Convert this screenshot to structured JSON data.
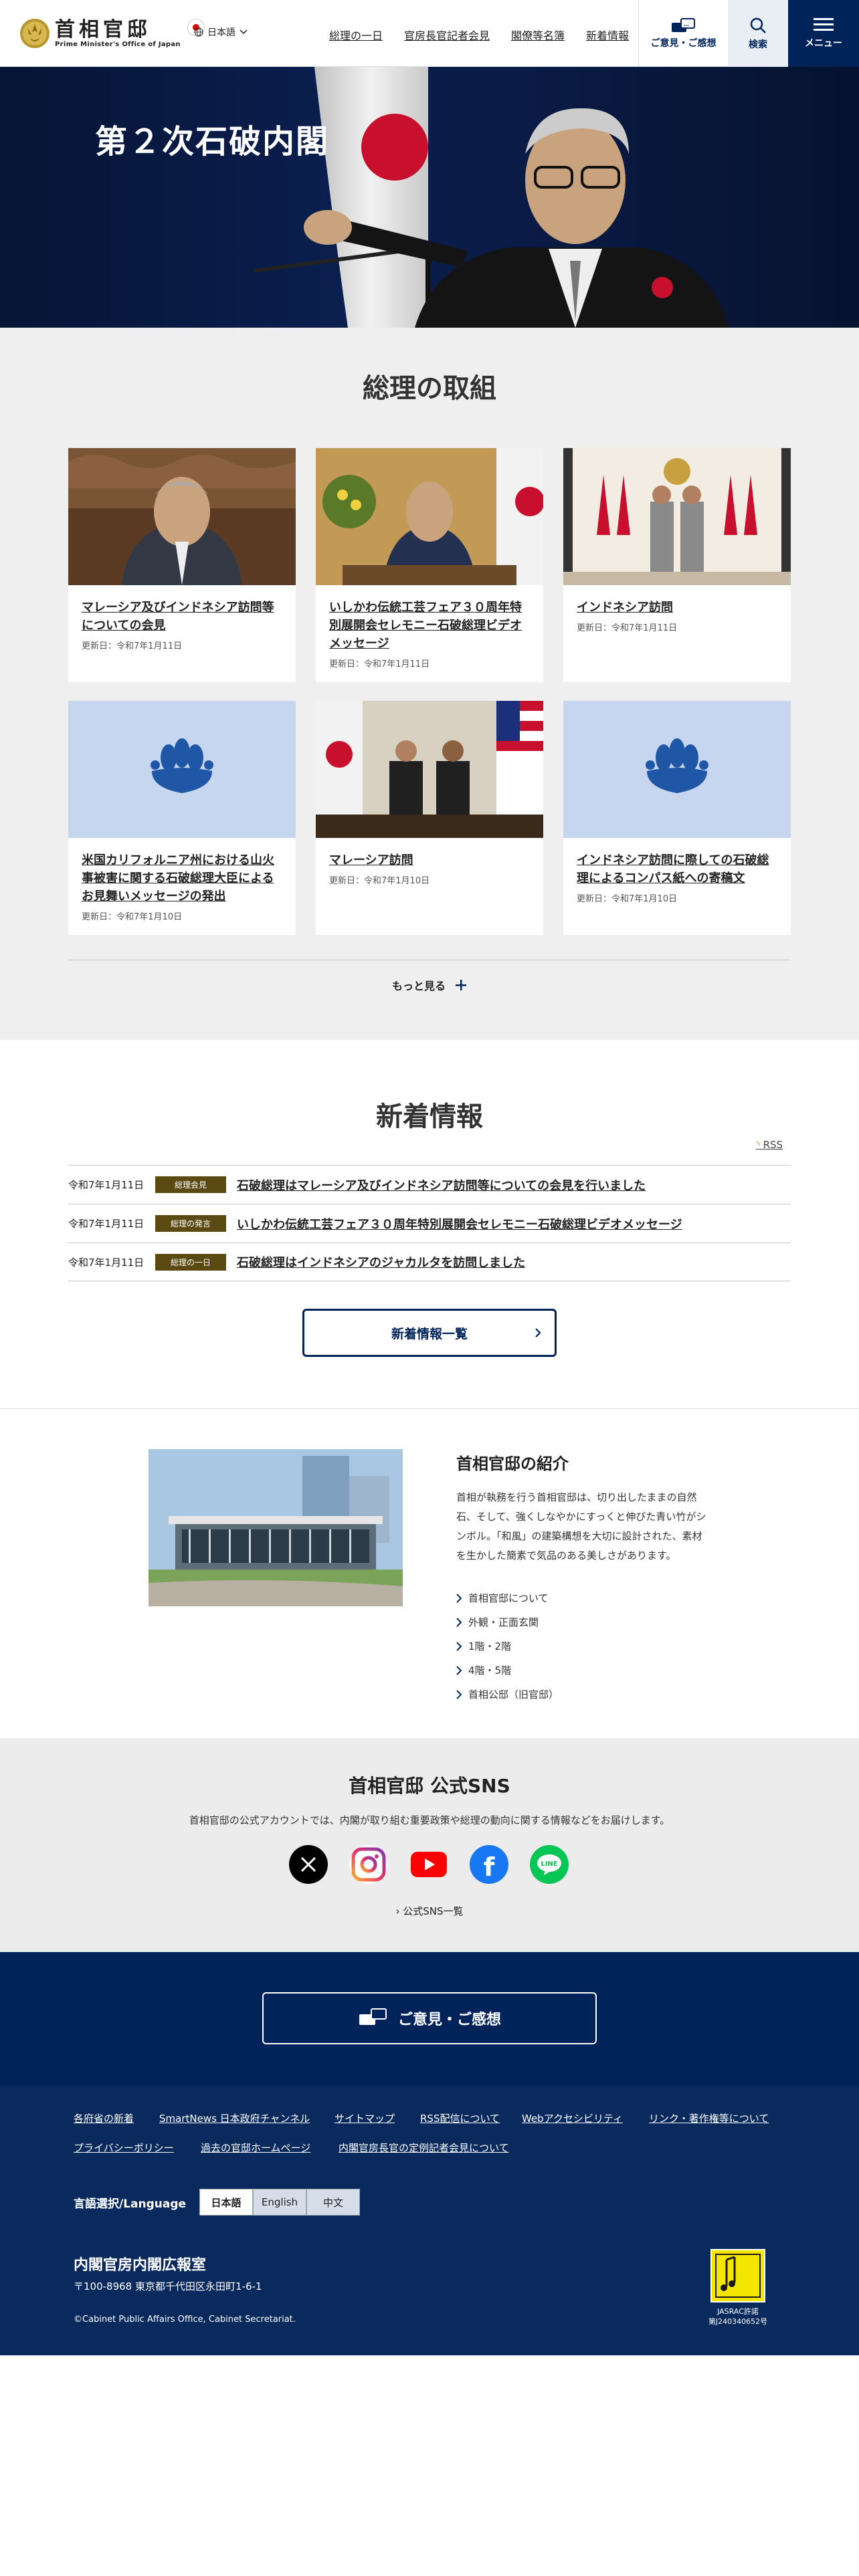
{
  "header": {
    "logo_jp": "首相官邸",
    "logo_en": "Prime Minister's Office of Japan",
    "language": "日本語",
    "nav": [
      "総理の一日",
      "官房長官記者会見",
      "閣僚等名簿",
      "新着情報"
    ],
    "opinion": "ご意見・ご感想",
    "search": "検索",
    "menu": "メニュー"
  },
  "hero": {
    "title": "第２次石破内閣"
  },
  "activities": {
    "heading": "総理の取組",
    "cards": [
      {
        "title": "マレーシア及びインドネシア訪問等についての会見",
        "date": "更新日：令和7年1月11日"
      },
      {
        "title": "いしかわ伝統工芸フェア３０周年特別展開会セレモニー石破総理ビデオメッセージ",
        "date": "更新日：令和7年1月11日"
      },
      {
        "title": "インドネシア訪問",
        "date": "更新日：令和7年1月11日"
      },
      {
        "title": "米国カリフォルニア州における山火事被害に関する石破総理大臣によるお見舞いメッセージの発出",
        "date": "更新日：令和7年1月10日"
      },
      {
        "title": "マレーシア訪問",
        "date": "更新日：令和7年1月10日"
      },
      {
        "title": "インドネシア訪問に際しての石破総理によるコンパス紙への寄稿文",
        "date": "更新日：令和7年1月10日"
      }
    ],
    "more": "もっと見る"
  },
  "news": {
    "heading": "新着情報",
    "rss": "RSS",
    "items": [
      {
        "date": "令和7年1月11日",
        "badge": "総理会見",
        "title": "石破総理はマレーシア及びインドネシア訪問等についての会見を行いました"
      },
      {
        "date": "令和7年1月11日",
        "badge": "総理の発言",
        "title": "いしかわ伝統工芸フェア３０周年特別展開会セレモニー石破総理ビデオメッセージ"
      },
      {
        "date": "令和7年1月11日",
        "badge": "総理の一日",
        "title": "石破総理はインドネシアのジャカルタを訪問しました"
      }
    ],
    "all_button": "新着情報一覧"
  },
  "kantei": {
    "heading": "首相官邸の紹介",
    "text": "首相が執務を行う首相官邸は、切り出したままの自然石、そして、強くしなやかにすっくと伸びた青い竹がシンボル。「和風」の建築構想を大切に設計された、素材を生かした簡素で気品のある美しさがあります。",
    "links": [
      "首相官邸について",
      "外観・正面玄関",
      "1階・2階",
      "4階・5階",
      "首相公邸（旧官邸）"
    ]
  },
  "sns": {
    "heading": "首相官邸 公式SNS",
    "text": "首相官邸の公式アカウントでは、内閣が取り組む重要政策や総理の動向に関する情報などをお届けします。",
    "icons": [
      "x-icon",
      "instagram-icon",
      "youtube-icon",
      "facebook-icon",
      "line-icon"
    ],
    "line_label": "LINE",
    "list_link": "公式SNS一覧"
  },
  "opinion_banner": {
    "label": "ご意見・ご感想"
  },
  "footer": {
    "links_row1": [
      "各府省の新着",
      "SmartNews 日本政府チャンネル",
      "サイトマップ",
      "RSS配信について",
      "Webアクセシビリティ",
      "リンク・著作権等について"
    ],
    "links_row2": [
      "プライバシーポリシー",
      "過去の官邸ホームページ",
      "内閣官房長官の定例記者会見について"
    ],
    "lang_label": "言語選択/Language",
    "langs": [
      "日本語",
      "English",
      "中文"
    ],
    "org": "内閣官房内閣広報室",
    "address": "〒100-8968 東京都千代田区永田町1-6-1",
    "copyright": "©Cabinet Public Affairs Office, Cabinet Secretariat.",
    "jasrac": "JASRAC許諾\n第J240340652号"
  },
  "colors": {
    "navy": "#00245a",
    "badge": "#5a4a12",
    "bg_gray": "#efefef"
  }
}
